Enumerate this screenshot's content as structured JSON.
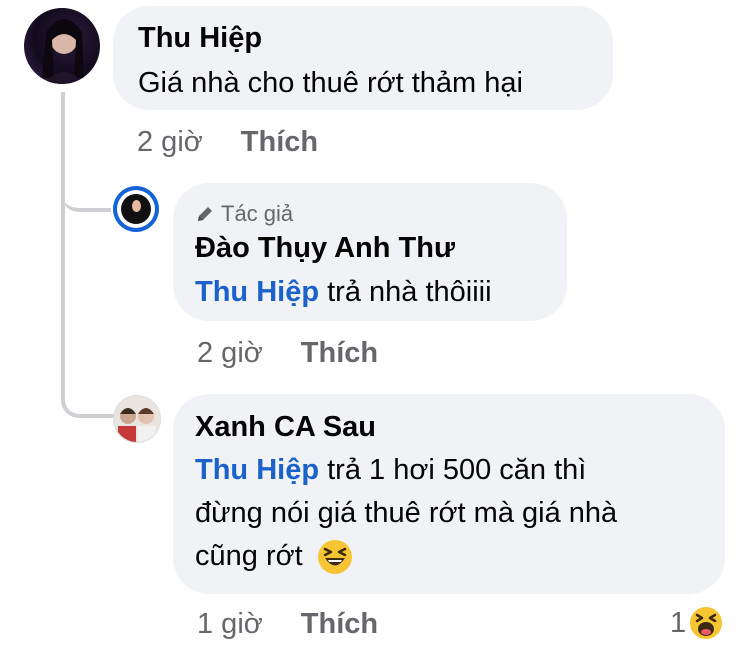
{
  "comments": [
    {
      "author": "Thu Hiệp",
      "text": "Giá nhà cho thuê rớt thảm hại",
      "time": "2 giờ",
      "like_label": "Thích"
    },
    {
      "author_badge": "Tác giả",
      "author": "Đào Thụy Anh Thư",
      "mention": "Thu Hiệp",
      "text": " trả nhà thôiiii",
      "time": "2 giờ",
      "like_label": "Thích"
    },
    {
      "author": "Xanh CA Sau",
      "mention": "Thu Hiệp",
      "text_line1": " trả 1 hơi 500 căn thì",
      "text_line2": "đừng nói giá thuê rớt mà giá nhà",
      "text_line3": "cũng rớt",
      "emoji": "laughing-emoji",
      "time": "1 giờ",
      "like_label": "Thích",
      "reaction_count": "1",
      "reaction_icon": "laughing-reaction-icon"
    }
  ],
  "colors": {
    "bubble": "#f0f2f5",
    "mention": "#1a61c9",
    "meta": "#65676b",
    "thread_line": "#ced0d4",
    "emoji_yellow": "#f7c433"
  }
}
